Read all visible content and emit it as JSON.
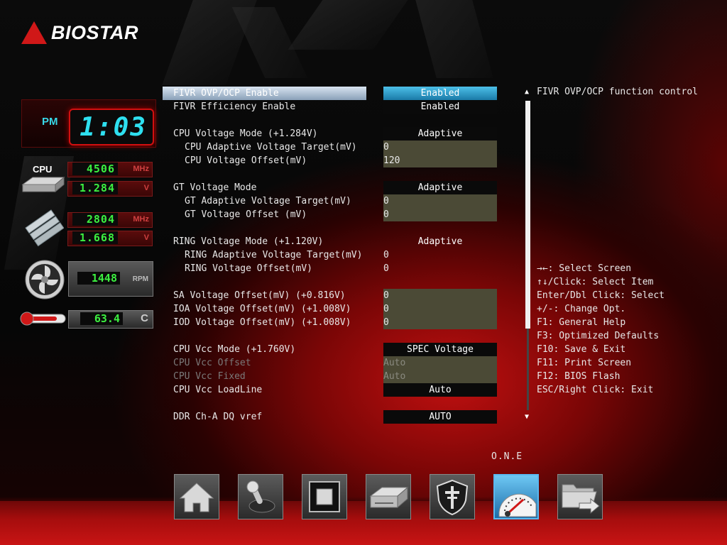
{
  "brand": {
    "logo_text": "BIOSTAR"
  },
  "monitor": {
    "ampm": "PM",
    "time": "1:03",
    "cpu_label": "CPU",
    "cpu_freq": "4506",
    "cpu_freq_unit": "MHz",
    "cpu_volt": "1.284",
    "cpu_volt_unit": "V",
    "mem_freq": "2804",
    "mem_freq_unit": "MHz",
    "mem_volt": "1.668",
    "mem_volt_unit": "V",
    "fan_speed": "1448",
    "fan_unit": "RPM",
    "temp": "63.4",
    "temp_unit": "C"
  },
  "settings": [
    {
      "label": "FIVR OVP/OCP Enable",
      "value": "Enabled"
    },
    {
      "label": "FIVR Efficiency Enable",
      "value": "Enabled"
    },
    {
      "label": "CPU Voltage Mode (+1.284V)",
      "value": "Adaptive"
    },
    {
      "label": "CPU Adaptive Voltage Target(mV)",
      "value": "0"
    },
    {
      "label": "CPU Voltage Offset(mV)",
      "value": "120"
    },
    {
      "label": "GT Voltage Mode",
      "value": "Adaptive"
    },
    {
      "label": "GT Adaptive Voltage Target(mV)",
      "value": "0"
    },
    {
      "label": "GT Voltage Offset (mV)",
      "value": "0"
    },
    {
      "label": "RING Voltage Mode (+1.120V)",
      "value": "Adaptive"
    },
    {
      "label": "RING Adaptive Voltage Target(mV)",
      "value": "0"
    },
    {
      "label": "RING Voltage Offset(mV)",
      "value": "0"
    },
    {
      "label": "SA Voltage Offset(mV) (+0.816V)",
      "value": "0"
    },
    {
      "label": "IOA Voltage Offset(mV) (+1.008V)",
      "value": "0"
    },
    {
      "label": "IOD Voltage Offset(mV) (+1.008V)",
      "value": "0"
    },
    {
      "label": "CPU Vcc Mode (+1.760V)",
      "value": "SPEC Voltage"
    },
    {
      "label": "CPU Vcc Offset",
      "value": "Auto"
    },
    {
      "label": "CPU Vcc Fixed",
      "value": "Auto"
    },
    {
      "label": "CPU Vcc LoadLine",
      "value": "Auto"
    },
    {
      "label": "DDR Ch-A DQ vref",
      "value": "AUTO"
    }
  ],
  "help": {
    "description": "FIVR OVP/OCP function control",
    "keys": [
      "→←: Select Screen",
      "↑↓/Click: Select Item",
      "Enter/Dbl Click: Select",
      "+/-: Change Opt.",
      "F1: General Help",
      "F3: Optimized Defaults",
      "F10: Save & Exit",
      "F11: Print Screen",
      "F12: BIOS Flash",
      "ESC/Right Click: Exit"
    ]
  },
  "nav": {
    "active_label": "O.N.E",
    "tabs": [
      "home-icon",
      "joystick-icon",
      "chip-icon",
      "drive-icon",
      "shield-icon",
      "gauge-icon",
      "folder-exit-icon"
    ],
    "active_index": 5
  },
  "colors": {
    "accent_red": "#c81414",
    "highlight_blue": "#1a7aa8",
    "digit_green": "#3cf040",
    "clock_cyan": "#2ee0f0"
  }
}
